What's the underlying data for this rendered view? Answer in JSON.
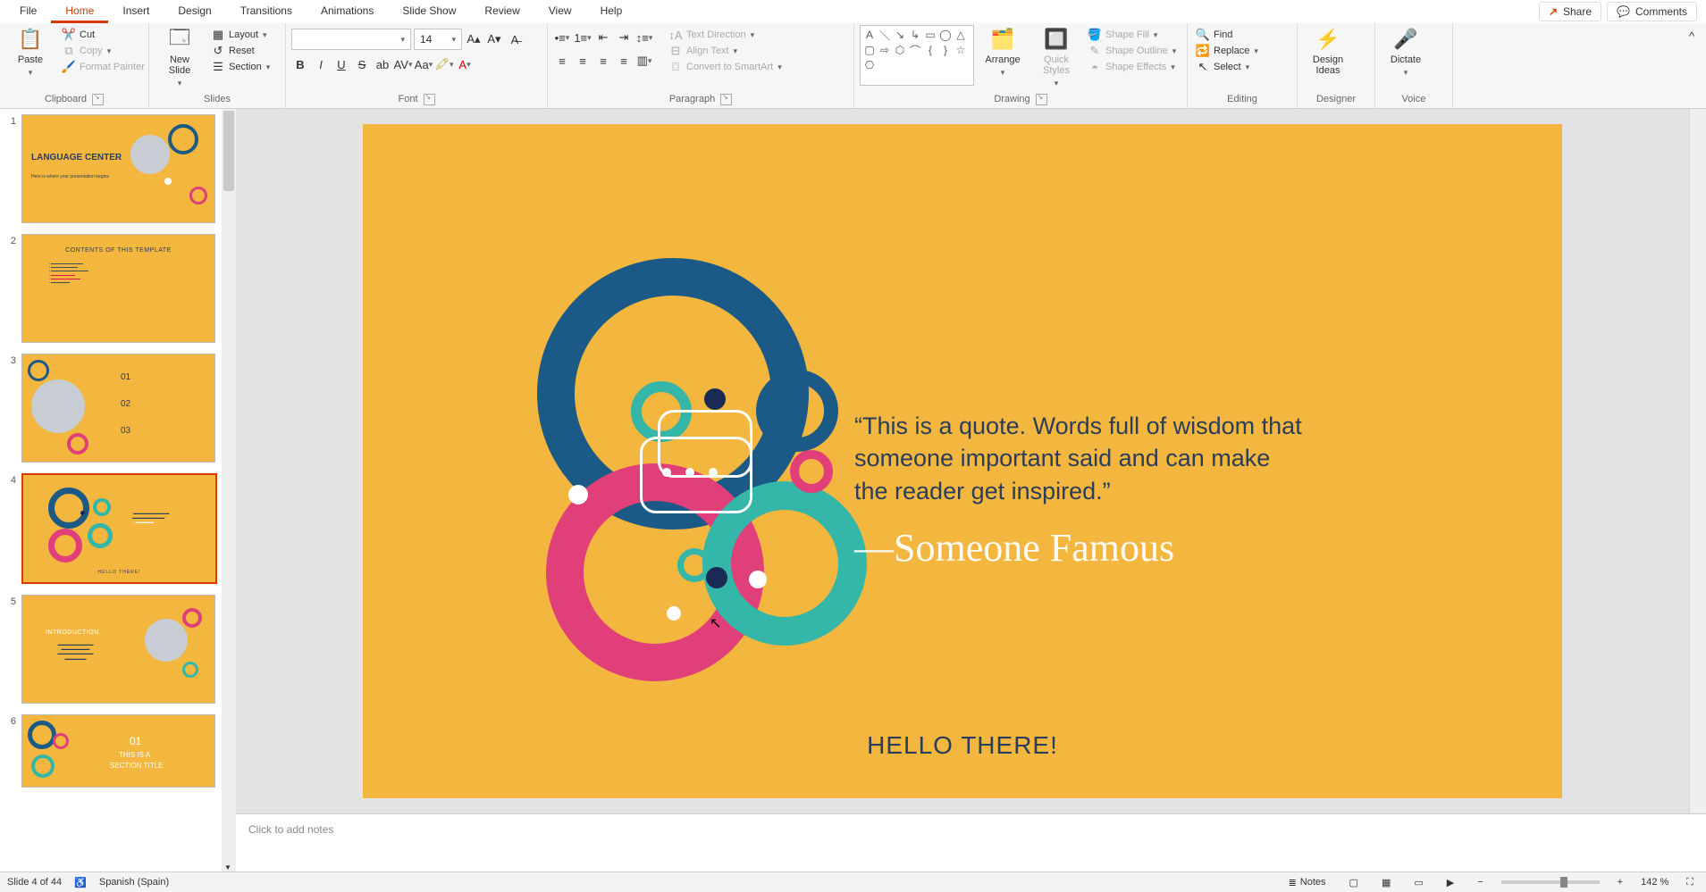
{
  "menu": {
    "tabs": [
      "File",
      "Home",
      "Insert",
      "Design",
      "Transitions",
      "Animations",
      "Slide Show",
      "Review",
      "View",
      "Help"
    ],
    "active": 1
  },
  "top_right": {
    "share": "Share",
    "comments": "Comments"
  },
  "ribbon": {
    "clipboard": {
      "label": "Clipboard",
      "paste": "Paste",
      "cut": "Cut",
      "copy": "Copy",
      "fmt": "Format Painter"
    },
    "slides": {
      "label": "Slides",
      "new_slide": "New\nSlide",
      "layout": "Layout",
      "reset": "Reset",
      "section": "Section"
    },
    "font": {
      "label": "Font",
      "size": "14"
    },
    "paragraph": {
      "label": "Paragraph",
      "text_dir": "Text Direction",
      "align_text": "Align Text",
      "smartart": "Convert to SmartArt"
    },
    "drawing": {
      "label": "Drawing",
      "arrange": "Arrange",
      "quick": "Quick\nStyles",
      "fill": "Shape Fill",
      "outline": "Shape Outline",
      "effects": "Shape Effects"
    },
    "editing": {
      "label": "Editing",
      "find": "Find",
      "replace": "Replace",
      "select": "Select"
    },
    "designer": {
      "label": "Designer",
      "btn": "Design\nIdeas"
    },
    "voice": {
      "label": "Voice",
      "btn": "Dictate"
    }
  },
  "slide": {
    "quote": "“This is a quote. Words full of wisdom that someone important said and can make the reader get inspired.”",
    "attr": "—Someone Famous",
    "hello": "HELLO THERE!"
  },
  "thumbs": {
    "t1": {
      "title": "LANGUAGE CENTER",
      "sub": "Here is where your presentation begins"
    },
    "t2": {
      "title": "CONTENTS OF THIS TEMPLATE"
    },
    "t3": {
      "n1": "01",
      "n2": "02",
      "n3": "03"
    },
    "t5": {
      "title": "INTRODUCTION"
    },
    "t6": {
      "n": "01",
      "title": "THIS IS A",
      "sub": "SECTION TITLE"
    }
  },
  "notes": {
    "placeholder": "Click to add notes"
  },
  "status": {
    "slide": "Slide 4 of 44",
    "lang": "Spanish (Spain)",
    "notes": "Notes",
    "zoom": "142 %"
  }
}
